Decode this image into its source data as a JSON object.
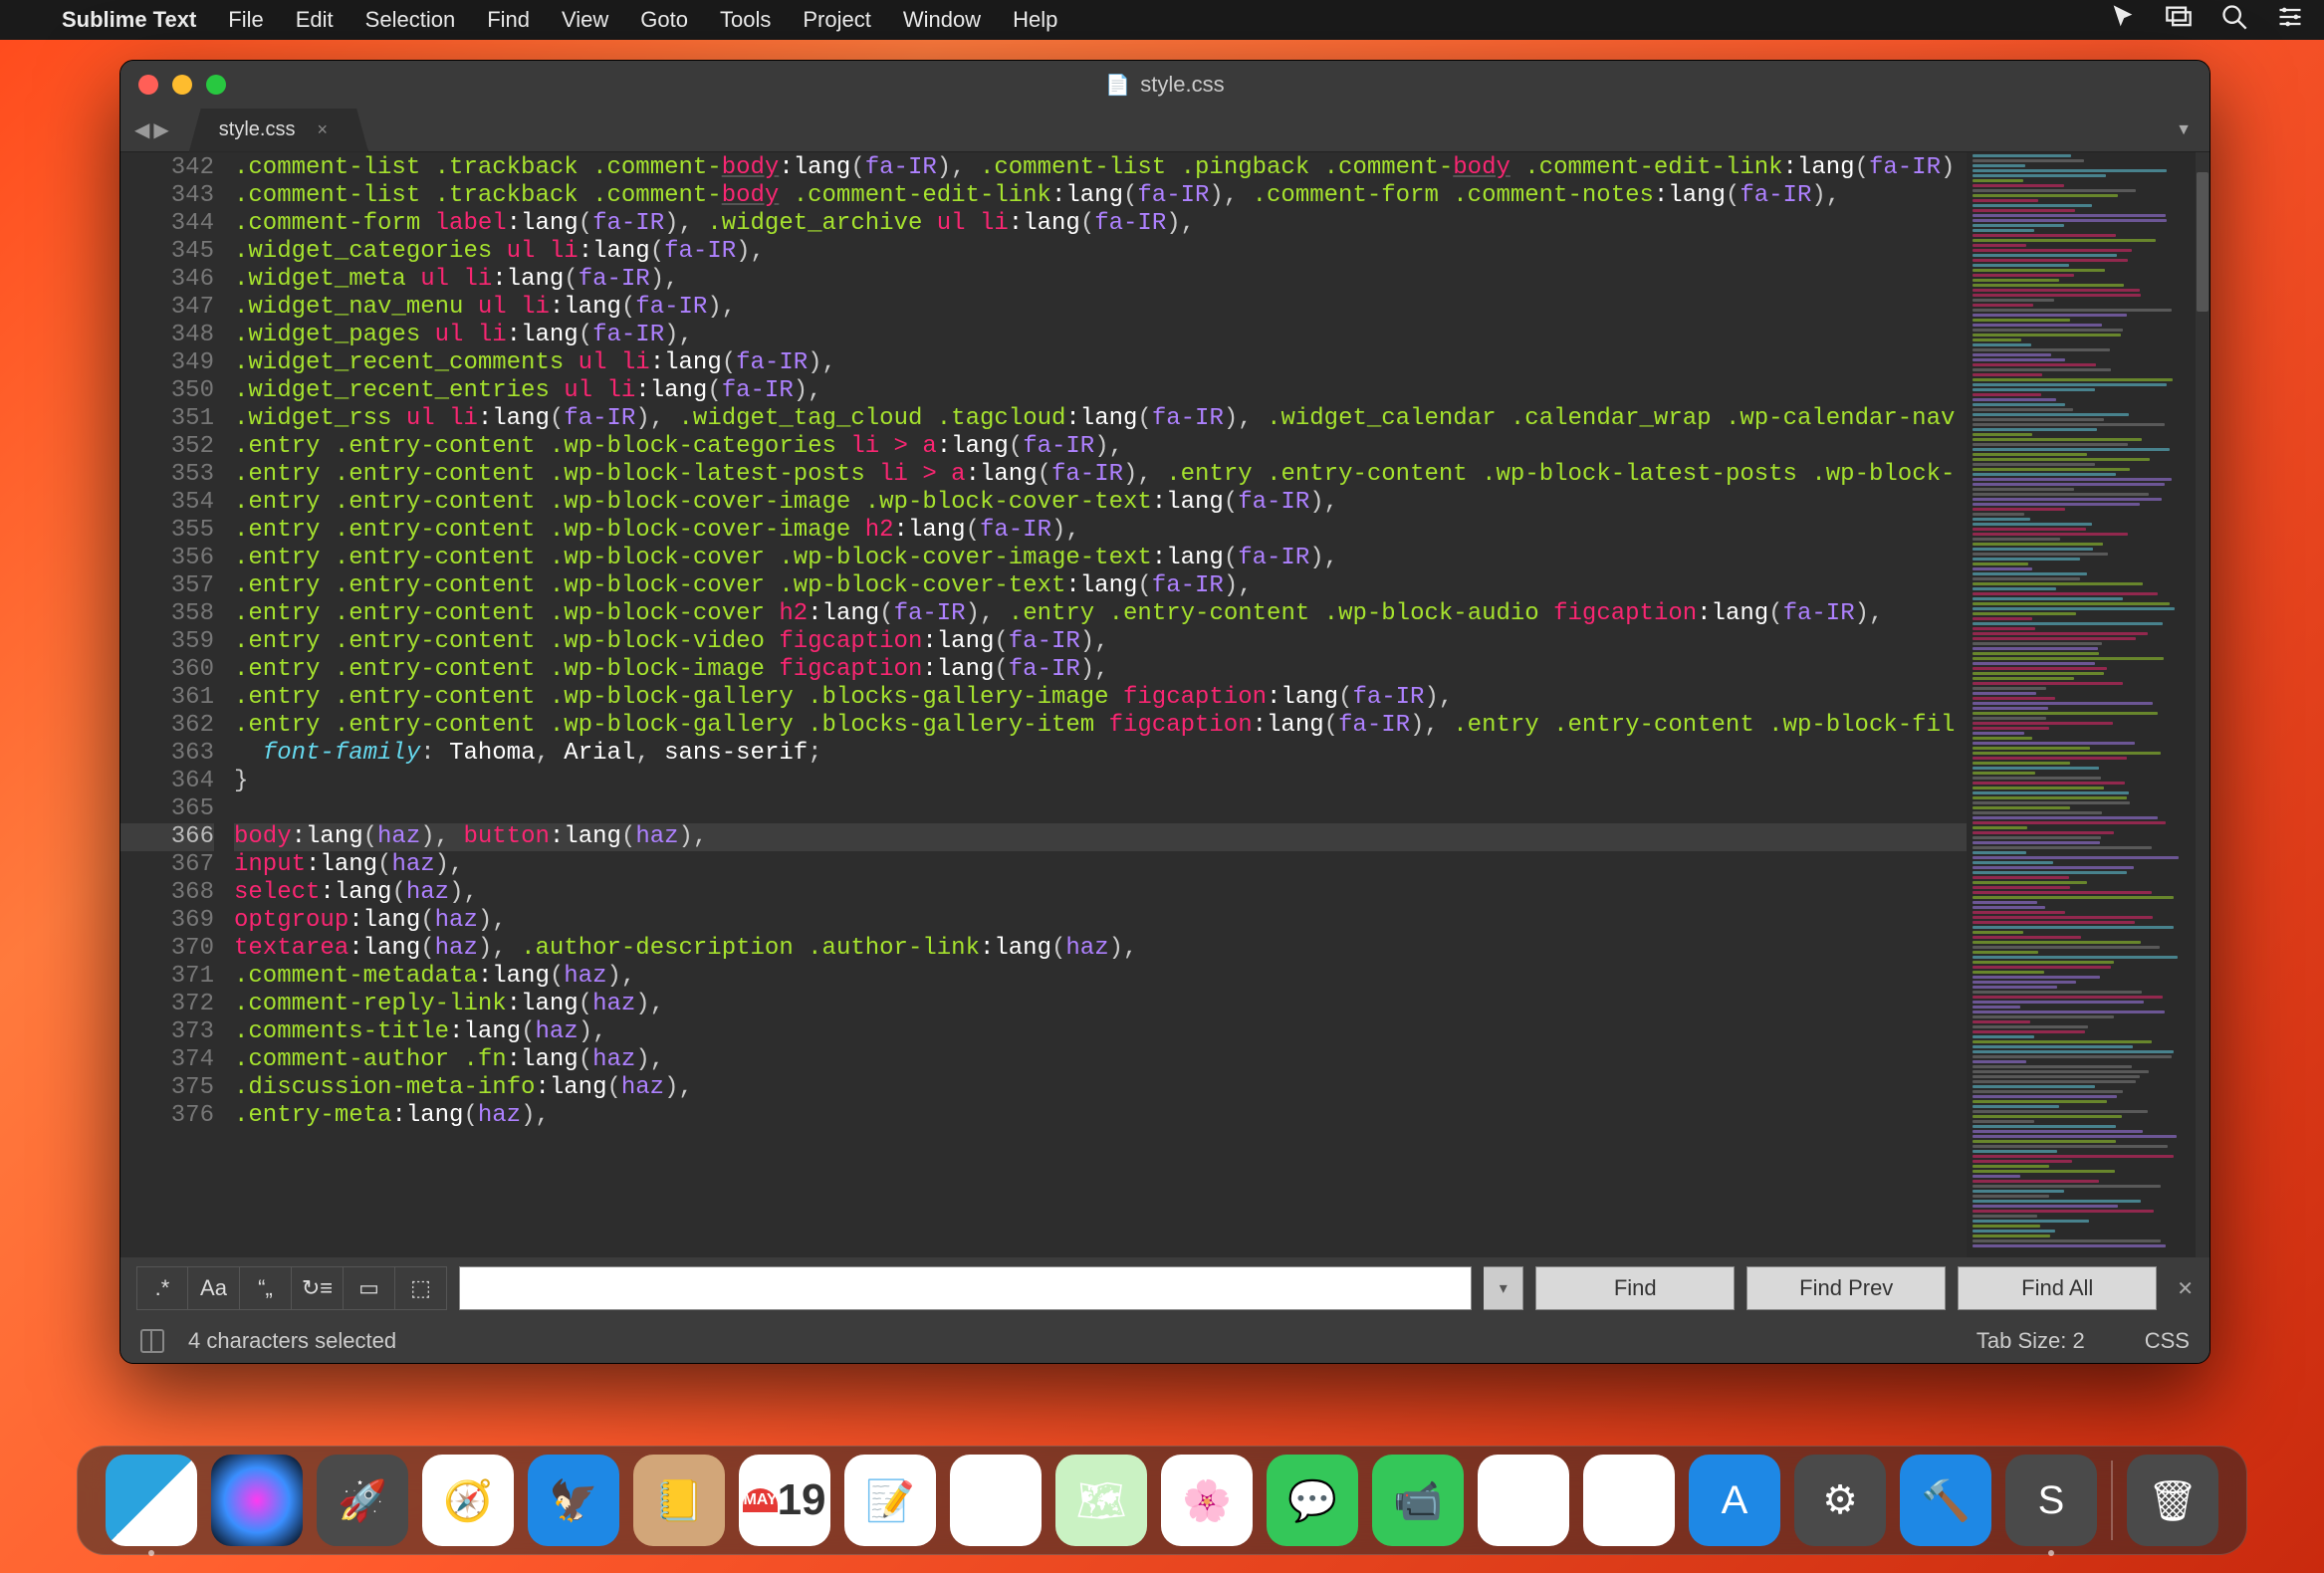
{
  "menubar": {
    "app": "Sublime Text",
    "items": [
      "File",
      "Edit",
      "Selection",
      "Find",
      "View",
      "Goto",
      "Tools",
      "Project",
      "Window",
      "Help"
    ]
  },
  "window": {
    "title": "style.css",
    "tab": "style.css",
    "tab_close": "×"
  },
  "find": {
    "regex": ".*",
    "case": "Aa",
    "whole_word": "“„",
    "wrap": "↻≡",
    "in_selection": "▭",
    "highlight": "⬚",
    "input_value": "",
    "find_btn": "Find",
    "find_prev_btn": "Find Prev",
    "find_all_btn": "Find All"
  },
  "status": {
    "selection": "4 characters selected",
    "tab_size": "Tab Size: 2",
    "syntax": "CSS"
  },
  "calendar": {
    "month": "MAY",
    "day": "19"
  },
  "gutter_start": 342,
  "gutter_end": 376,
  "highlighted_line": 366,
  "code_lines": [
    {
      "n": 342,
      "html": "<span class='sel'>.comment-list</span> <span class='sel'>.trackback</span> <span class='sel'>.comment-</span><span class='tag underline'>body</span><span class='ps'>:lang</span><span class='punc'>(</span><span class='num'>fa-IR</span><span class='punc'>)</span><span class='punc'>,</span> <span class='sel'>.comment-list</span> <span class='sel'>.pingback</span> <span class='sel'>.comment-</span><span class='tag underline'>body</span> <span class='sel'>.comment-edit-link</span><span class='ps'>:lang</span><span class='punc'>(</span><span class='num'>fa-IR</span><span class='punc'>)</span>"
    },
    {
      "n": 343,
      "html": "<span class='sel'>.comment-list</span> <span class='sel'>.trackback</span> <span class='sel'>.comment-</span><span class='tag underline'>body</span> <span class='sel'>.comment-edit-link</span><span class='ps'>:lang</span><span class='punc'>(</span><span class='num'>fa-IR</span><span class='punc'>)</span><span class='punc'>,</span> <span class='sel'>.comment-form</span> <span class='sel'>.comment-notes</span><span class='ps'>:lang</span><span class='punc'>(</span><span class='num'>fa-IR</span><span class='punc'>)</span><span class='punc'>,</span>"
    },
    {
      "n": 344,
      "html": "<span class='sel'>.comment-form</span> <span class='tag'>label</span><span class='ps'>:lang</span><span class='punc'>(</span><span class='num'>fa-IR</span><span class='punc'>)</span><span class='punc'>,</span> <span class='sel'>.widget_archive</span> <span class='tag'>ul</span> <span class='tag'>li</span><span class='ps'>:lang</span><span class='punc'>(</span><span class='num'>fa-IR</span><span class='punc'>)</span><span class='punc'>,</span>"
    },
    {
      "n": 345,
      "html": "<span class='sel'>.widget_categories</span> <span class='tag'>ul</span> <span class='tag'>li</span><span class='ps'>:lang</span><span class='punc'>(</span><span class='num'>fa-IR</span><span class='punc'>)</span><span class='punc'>,</span>"
    },
    {
      "n": 346,
      "html": "<span class='sel'>.widget_meta</span> <span class='tag'>ul</span> <span class='tag'>li</span><span class='ps'>:lang</span><span class='punc'>(</span><span class='num'>fa-IR</span><span class='punc'>)</span><span class='punc'>,</span>"
    },
    {
      "n": 347,
      "html": "<span class='sel'>.widget_nav_menu</span> <span class='tag'>ul</span> <span class='tag'>li</span><span class='ps'>:lang</span><span class='punc'>(</span><span class='num'>fa-IR</span><span class='punc'>)</span><span class='punc'>,</span>"
    },
    {
      "n": 348,
      "html": "<span class='sel'>.widget_pages</span> <span class='tag'>ul</span> <span class='tag'>li</span><span class='ps'>:lang</span><span class='punc'>(</span><span class='num'>fa-IR</span><span class='punc'>)</span><span class='punc'>,</span>"
    },
    {
      "n": 349,
      "html": "<span class='sel'>.widget_recent_comments</span> <span class='tag'>ul</span> <span class='tag'>li</span><span class='ps'>:lang</span><span class='punc'>(</span><span class='num'>fa-IR</span><span class='punc'>)</span><span class='punc'>,</span>"
    },
    {
      "n": 350,
      "html": "<span class='sel'>.widget_recent_entries</span> <span class='tag'>ul</span> <span class='tag'>li</span><span class='ps'>:lang</span><span class='punc'>(</span><span class='num'>fa-IR</span><span class='punc'>)</span><span class='punc'>,</span>"
    },
    {
      "n": 351,
      "html": "<span class='sel'>.widget_rss</span> <span class='tag'>ul</span> <span class='tag'>li</span><span class='ps'>:lang</span><span class='punc'>(</span><span class='num'>fa-IR</span><span class='punc'>)</span><span class='punc'>,</span> <span class='sel'>.widget_tag_cloud</span> <span class='sel'>.tagcloud</span><span class='ps'>:lang</span><span class='punc'>(</span><span class='num'>fa-IR</span><span class='punc'>)</span><span class='punc'>,</span> <span class='sel'>.widget_calendar</span> <span class='sel'>.calendar_wrap</span> <span class='sel'>.wp-calendar-nav</span>"
    },
    {
      "n": 352,
      "html": "<span class='sel'>.entry</span> <span class='sel'>.entry-content</span> <span class='sel'>.wp-block-categories</span> <span class='tag'>li</span> <span class='op'>&gt;</span> <span class='tag'>a</span><span class='ps'>:lang</span><span class='punc'>(</span><span class='num'>fa-IR</span><span class='punc'>)</span><span class='punc'>,</span>"
    },
    {
      "n": 353,
      "html": "<span class='sel'>.entry</span> <span class='sel'>.entry-content</span> <span class='sel'>.wp-block-latest-posts</span> <span class='tag'>li</span> <span class='op'>&gt;</span> <span class='tag'>a</span><span class='ps'>:lang</span><span class='punc'>(</span><span class='num'>fa-IR</span><span class='punc'>)</span><span class='punc'>,</span> <span class='sel'>.entry</span> <span class='sel'>.entry-content</span> <span class='sel'>.wp-block-latest-posts</span> <span class='sel'>.wp-block-</span>"
    },
    {
      "n": 354,
      "html": "<span class='sel'>.entry</span> <span class='sel'>.entry-content</span> <span class='sel'>.wp-block-cover-image</span> <span class='sel'>.wp-block-cover-text</span><span class='ps'>:lang</span><span class='punc'>(</span><span class='num'>fa-IR</span><span class='punc'>)</span><span class='punc'>,</span>"
    },
    {
      "n": 355,
      "html": "<span class='sel'>.entry</span> <span class='sel'>.entry-content</span> <span class='sel'>.wp-block-cover-image</span> <span class='tag'>h2</span><span class='ps'>:lang</span><span class='punc'>(</span><span class='num'>fa-IR</span><span class='punc'>)</span><span class='punc'>,</span>"
    },
    {
      "n": 356,
      "html": "<span class='sel'>.entry</span> <span class='sel'>.entry-content</span> <span class='sel'>.wp-block-cover</span> <span class='sel'>.wp-block-cover-image-text</span><span class='ps'>:lang</span><span class='punc'>(</span><span class='num'>fa-IR</span><span class='punc'>)</span><span class='punc'>,</span>"
    },
    {
      "n": 357,
      "html": "<span class='sel'>.entry</span> <span class='sel'>.entry-content</span> <span class='sel'>.wp-block-cover</span> <span class='sel'>.wp-block-cover-text</span><span class='ps'>:lang</span><span class='punc'>(</span><span class='num'>fa-IR</span><span class='punc'>)</span><span class='punc'>,</span>"
    },
    {
      "n": 358,
      "html": "<span class='sel'>.entry</span> <span class='sel'>.entry-content</span> <span class='sel'>.wp-block-cover</span> <span class='tag'>h2</span><span class='ps'>:lang</span><span class='punc'>(</span><span class='num'>fa-IR</span><span class='punc'>)</span><span class='punc'>,</span> <span class='sel'>.entry</span> <span class='sel'>.entry-content</span> <span class='sel'>.wp-block-audio</span> <span class='tag'>figcaption</span><span class='ps'>:lang</span><span class='punc'>(</span><span class='num'>fa-IR</span><span class='punc'>)</span><span class='punc'>,</span>"
    },
    {
      "n": 359,
      "html": "<span class='sel'>.entry</span> <span class='sel'>.entry-content</span> <span class='sel'>.wp-block-video</span> <span class='tag'>figcaption</span><span class='ps'>:lang</span><span class='punc'>(</span><span class='num'>fa-IR</span><span class='punc'>)</span><span class='punc'>,</span>"
    },
    {
      "n": 360,
      "html": "<span class='sel'>.entry</span> <span class='sel'>.entry-content</span> <span class='sel'>.wp-block-image</span> <span class='tag'>figcaption</span><span class='ps'>:lang</span><span class='punc'>(</span><span class='num'>fa-IR</span><span class='punc'>)</span><span class='punc'>,</span>"
    },
    {
      "n": 361,
      "html": "<span class='sel'>.entry</span> <span class='sel'>.entry-content</span> <span class='sel'>.wp-block-gallery</span> <span class='sel'>.blocks-gallery-image</span> <span class='tag'>figcaption</span><span class='ps'>:lang</span><span class='punc'>(</span><span class='num'>fa-IR</span><span class='punc'>)</span><span class='punc'>,</span>"
    },
    {
      "n": 362,
      "html": "<span class='sel'>.entry</span> <span class='sel'>.entry-content</span> <span class='sel'>.wp-block-gallery</span> <span class='sel'>.blocks-gallery-item</span> <span class='tag'>figcaption</span><span class='ps'>:lang</span><span class='punc'>(</span><span class='num'>fa-IR</span><span class='punc'>)</span><span class='punc'>,</span> <span class='sel'>.entry</span> <span class='sel'>.entry-content</span> <span class='sel'>.wp-block-fil</span>"
    },
    {
      "n": 363,
      "html": "  <span class='kw'>font-family</span><span class='punc'>:</span> <span class='val'>Tahoma</span><span class='punc'>,</span> <span class='val'>Arial</span><span class='punc'>,</span> <span class='val'>sans-serif</span><span class='punc'>;</span>"
    },
    {
      "n": 364,
      "html": "<span class='punc'>}</span>"
    },
    {
      "n": 365,
      "html": ""
    },
    {
      "n": 366,
      "html": "<span class='tag'>body</span><span class='ps'>:lang</span><span class='punc'>(</span><span class='num'>haz</span><span class='punc'>)</span><span class='punc'>,</span> <span class='tag'>button</span><span class='ps'>:lang</span><span class='punc'>(</span><span class='num'>haz</span><span class='punc'>)</span><span class='punc'>,</span>",
      "hl": true
    },
    {
      "n": 367,
      "html": "<span class='tag'>input</span><span class='ps'>:lang</span><span class='punc'>(</span><span class='num'>haz</span><span class='punc'>)</span><span class='punc'>,</span>"
    },
    {
      "n": 368,
      "html": "<span class='tag'>select</span><span class='ps'>:lang</span><span class='punc'>(</span><span class='num'>haz</span><span class='punc'>)</span><span class='punc'>,</span>"
    },
    {
      "n": 369,
      "html": "<span class='tag'>optgroup</span><span class='ps'>:lang</span><span class='punc'>(</span><span class='num'>haz</span><span class='punc'>)</span><span class='punc'>,</span>"
    },
    {
      "n": 370,
      "html": "<span class='tag'>textarea</span><span class='ps'>:lang</span><span class='punc'>(</span><span class='num'>haz</span><span class='punc'>)</span><span class='punc'>,</span> <span class='sel'>.author-description</span> <span class='sel'>.author-link</span><span class='ps'>:lang</span><span class='punc'>(</span><span class='num'>haz</span><span class='punc'>)</span><span class='punc'>,</span>"
    },
    {
      "n": 371,
      "html": "<span class='sel'>.comment-metadata</span><span class='ps'>:lang</span><span class='punc'>(</span><span class='num'>haz</span><span class='punc'>)</span><span class='punc'>,</span>"
    },
    {
      "n": 372,
      "html": "<span class='sel'>.comment-reply-link</span><span class='ps'>:lang</span><span class='punc'>(</span><span class='num'>haz</span><span class='punc'>)</span><span class='punc'>,</span>"
    },
    {
      "n": 373,
      "html": "<span class='sel'>.comments-title</span><span class='ps'>:lang</span><span class='punc'>(</span><span class='num'>haz</span><span class='punc'>)</span><span class='punc'>,</span>"
    },
    {
      "n": 374,
      "html": "<span class='sel'>.comment-author</span> <span class='sel'>.fn</span><span class='ps'>:lang</span><span class='punc'>(</span><span class='num'>haz</span><span class='punc'>)</span><span class='punc'>,</span>"
    },
    {
      "n": 375,
      "html": "<span class='sel'>.discussion-meta-info</span><span class='ps'>:lang</span><span class='punc'>(</span><span class='num'>haz</span><span class='punc'>)</span><span class='punc'>,</span>"
    },
    {
      "n": 376,
      "html": "<span class='sel'>.entry-meta</span><span class='ps'>:lang</span><span class='punc'>(</span><span class='num'>haz</span><span class='punc'>)</span><span class='punc'>,</span>"
    }
  ],
  "dock_apps": [
    "finder",
    "siri",
    "launchpad",
    "safari",
    "mail",
    "contacts",
    "calendar",
    "notes",
    "reminders",
    "maps",
    "photos",
    "messages",
    "facetime",
    "news",
    "music",
    "appstore",
    "settings",
    "xcode",
    "sublime"
  ]
}
